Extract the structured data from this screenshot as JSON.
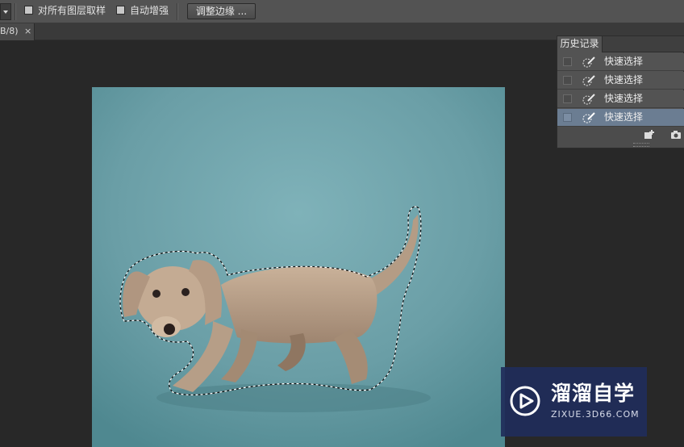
{
  "options_bar": {
    "sample_all_layers_label": "对所有图层取样",
    "auto_enhance_label": "自动增强",
    "refine_edge_button": "调整边缘 ..."
  },
  "document_tab": {
    "title": "B/8)",
    "close_glyph": "×"
  },
  "history_panel": {
    "tab_label": "历史记录",
    "items": [
      {
        "label": "快速选择",
        "selected": false
      },
      {
        "label": "快速选择",
        "selected": false
      },
      {
        "label": "快速选择",
        "selected": false
      },
      {
        "label": "快速选择",
        "selected": true
      }
    ],
    "footer_icons": [
      "new-snapshot-icon",
      "camera-icon"
    ]
  },
  "canvas": {
    "background_color": "#6a9ea6",
    "subject": "dachshund puppy with marching-ants selection"
  },
  "watermark": {
    "name": "溜溜自学",
    "url": "ZIXUE.3D66.COM"
  },
  "colors": {
    "selected_row": "#6b7d92",
    "watermark_bg": "#1f2d5a"
  }
}
